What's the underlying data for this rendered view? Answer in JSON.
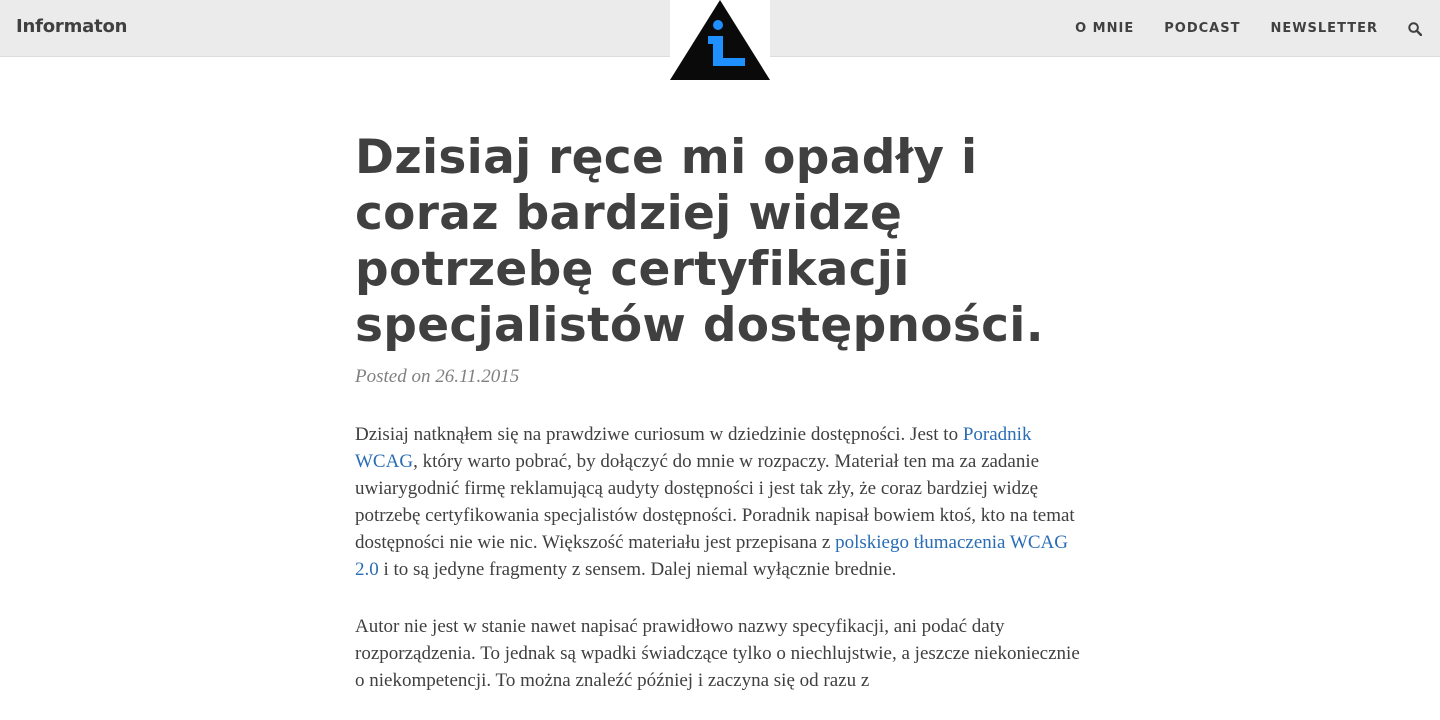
{
  "header": {
    "brand": "Informaton",
    "nav": [
      "O MNIE",
      "PODCAST",
      "NEWSLETTER"
    ],
    "search_icon": "search-icon",
    "logo": "info-triangle-logo"
  },
  "post": {
    "title": "Dzisiaj ręce mi opadły i coraz bardziej widzę potrzebę certyfikacji specjalistów dostępności.",
    "meta": "Posted on 26.11.2015",
    "p1": {
      "before_link1": "Dzisiaj natknąłem się na prawdziwe curiosum w dziedzinie dostępności. Jest to ",
      "link1": "Poradnik WCAG",
      "middle": ", który warto pobrać, by dołączyć do mnie w rozpaczy. Materiał ten ma za zadanie uwiarygodnić firmę reklamującą audyty dostępności i jest tak zły, że coraz bardziej widzę potrzebę certyfikowania specjalistów dostępności. Poradnik napisał bowiem ktoś, kto na temat dostępności nie wie nic. Większość materiału jest przepisana z ",
      "link2": "polskiego tłumaczenia WCAG 2.0",
      "after_link2": " i to są jedyne fragmenty z sensem. Dalej niemal wyłącznie brednie."
    },
    "p2": "Autor nie jest w stanie nawet napisać prawidłowo nazwy specyfikacji, ani podać daty rozporządzenia. To jednak są wpadki świadczące tylko o niechlujstwie, a jeszcze niekoniecznie o niekompetencji. To można znaleźć później i zaczyna się od razu z"
  },
  "colors": {
    "navbar_bg": "#ebebeb",
    "text": "#404040",
    "meta": "#808080",
    "link": "#2a6db5",
    "logo_blue": "#1e90ff"
  }
}
